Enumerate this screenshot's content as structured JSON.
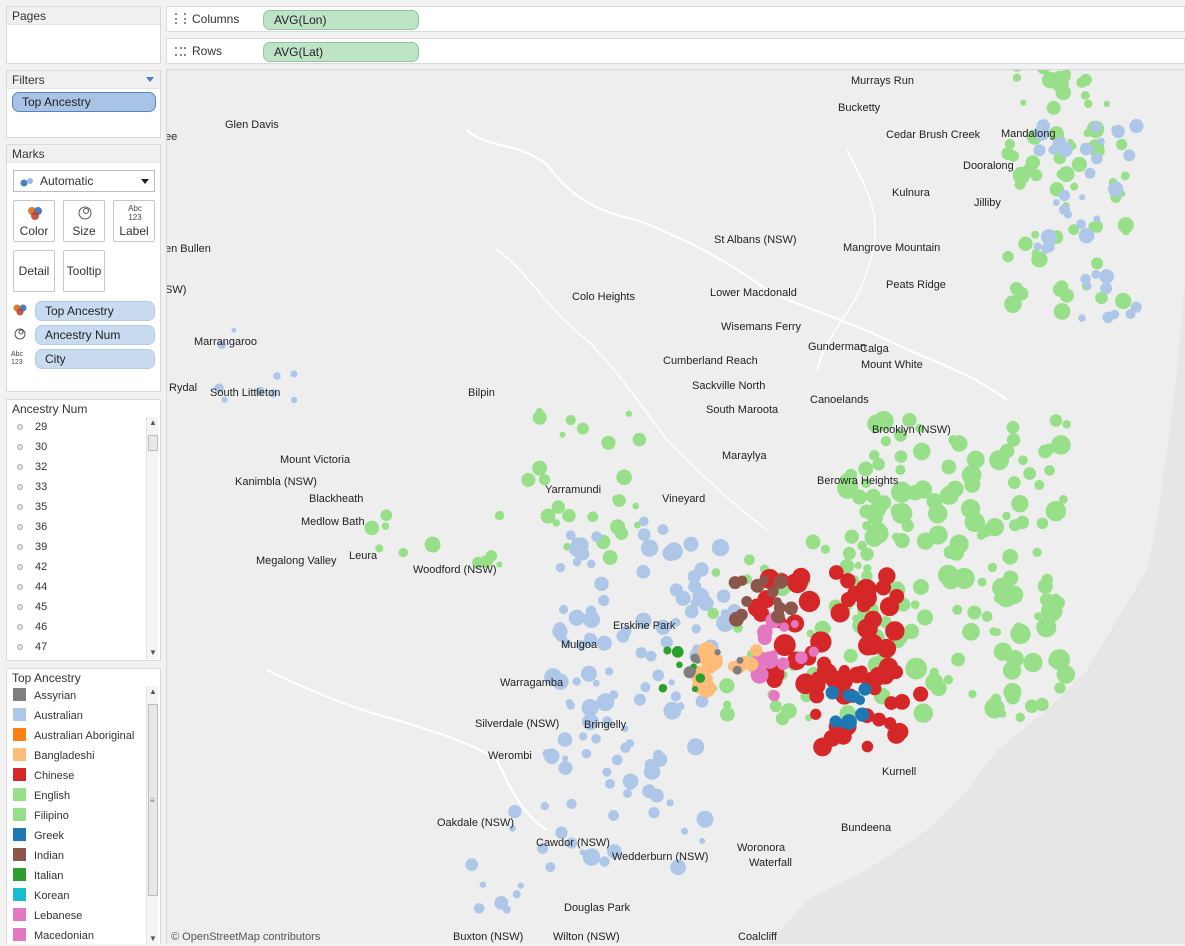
{
  "pages": {
    "title": "Pages"
  },
  "filters": {
    "title": "Filters",
    "items": [
      "Top Ancestry"
    ]
  },
  "marks": {
    "title": "Marks",
    "type": "Automatic",
    "buttons": {
      "color": "Color",
      "size": "Size",
      "label": "Label",
      "detail": "Detail",
      "tooltip": "Tooltip"
    },
    "label_icon_text": "Abc 123",
    "encodings": [
      "Top Ancestry",
      "Ancestry Num",
      "City"
    ]
  },
  "shelves": {
    "columns_label": "Columns",
    "columns_value": "AVG(Lon)",
    "rows_label": "Rows",
    "rows_value": "AVG(Lat)"
  },
  "ancestry_num": {
    "title": "Ancestry Num",
    "values": [
      "29",
      "30",
      "32",
      "33",
      "35",
      "36",
      "39",
      "42",
      "44",
      "45",
      "46",
      "47"
    ]
  },
  "top_ancestry": {
    "title": "Top Ancestry",
    "items": [
      {
        "label": "Assyrian",
        "color": "#7f7f7f"
      },
      {
        "label": "Australian",
        "color": "#aec7e8"
      },
      {
        "label": "Australian Aboriginal",
        "color": "#ff7f0e"
      },
      {
        "label": "Bangladeshi",
        "color": "#ffbb78"
      },
      {
        "label": "Chinese",
        "color": "#d62728"
      },
      {
        "label": "English",
        "color": "#98df8a"
      },
      {
        "label": "Filipino",
        "color": "#98df8a"
      },
      {
        "label": "Greek",
        "color": "#1f77b4"
      },
      {
        "label": "Indian",
        "color": "#8c564b"
      },
      {
        "label": "Italian",
        "color": "#2ca02c"
      },
      {
        "label": "Korean",
        "color": "#17becf"
      },
      {
        "label": "Lebanese",
        "color": "#e377c2"
      },
      {
        "label": "Macedonian",
        "color": "#e377c2"
      }
    ]
  },
  "map": {
    "attribution": "© OpenStreetMap contributors",
    "places": [
      "Murrays Run",
      "Bucketty",
      "Cedar Brush Creek",
      "Mandalong",
      "Dooralong",
      "Glen Davis",
      "Kulnura",
      "Jilliby",
      "St Albans (NSW)",
      "Mangrove Mountain",
      "Colo Heights",
      "Lower Macdonald",
      "Peats Ridge",
      "Wisemans Ferry",
      "Gunderman",
      "Calga",
      "Marrangaroo",
      "Cumberland Reach",
      "Mount White",
      "Sackville North",
      "South Littleton",
      "Bilpin",
      "Canoelands",
      "South Maroota",
      "Brooklyn (NSW)",
      "Mount Victoria",
      "Maraylya",
      "Kanimbla (NSW)",
      "Yarramundi",
      "Berowra Heights",
      "Blackheath",
      "Vineyard",
      "Medlow Bath",
      "Leura",
      "Megalong Valley",
      "Woodford (NSW)",
      "Erskine Park",
      "Mulgoa",
      "Warragamba",
      "Silverdale (NSW)",
      "Bringelly",
      "Werombi",
      "Kurnell",
      "Oakdale (NSW)",
      "Bundeena",
      "Cawdor (NSW)",
      "Woronora",
      "Wedderburn (NSW)",
      "Waterfall",
      "Douglas Park",
      "Buxton (NSW)",
      "Wilton (NSW)",
      "Coalcliff",
      "Rydal",
      "ee",
      "en Bullen",
      "SW)"
    ]
  }
}
